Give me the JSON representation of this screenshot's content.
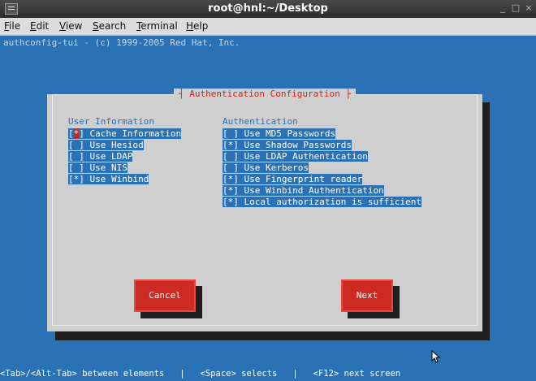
{
  "window": {
    "title": "root@hnl:~/Desktop",
    "controls": [
      "_",
      "□",
      "×"
    ]
  },
  "menubar": {
    "items": [
      {
        "label": "File",
        "mnemonic": "F"
      },
      {
        "label": "Edit",
        "mnemonic": "E"
      },
      {
        "label": "View",
        "mnemonic": "V"
      },
      {
        "label": "Search",
        "mnemonic": "S"
      },
      {
        "label": "Terminal",
        "mnemonic": "T"
      },
      {
        "label": "Help",
        "mnemonic": "H"
      }
    ]
  },
  "terminal": {
    "header_line": "authconfig-tui - (c) 1999-2005 Red Hat, Inc.",
    "dialog": {
      "title": "Authentication Configuration",
      "user_info": {
        "heading": "User Information",
        "rows": [
          {
            "mark": "*",
            "text": " Cache Information",
            "focused": true
          },
          {
            "mark": " ",
            "text": " Use Hesiod"
          },
          {
            "mark": " ",
            "text": " Use LDAP"
          },
          {
            "mark": " ",
            "text": " Use NIS"
          },
          {
            "mark": "*",
            "text": " Use Winbind"
          }
        ]
      },
      "authentication": {
        "heading": "Authentication",
        "rows": [
          {
            "mark": " ",
            "text": " Use MD5 Passwords"
          },
          {
            "mark": "*",
            "text": " Use Shadow Passwords"
          },
          {
            "mark": " ",
            "text": " Use LDAP Authentication"
          },
          {
            "mark": " ",
            "text": " Use Kerberos"
          },
          {
            "mark": "*",
            "text": " Use Fingerprint reader"
          },
          {
            "mark": "*",
            "text": " Use Winbind Authentication"
          },
          {
            "mark": "*",
            "text": " Local authorization is sufficient"
          }
        ]
      },
      "buttons": {
        "cancel": "Cancel",
        "next": "Next"
      }
    },
    "status_line": "<Tab>/<Alt-Tab> between elements   |   <Space> selects   |   <F12> next screen"
  },
  "colors": {
    "terminal_bg": "#2a72b5",
    "dialog_bg": "#cfcfcf",
    "accent_red": "#cc2a22",
    "titlebar": "#3a3a3a"
  }
}
